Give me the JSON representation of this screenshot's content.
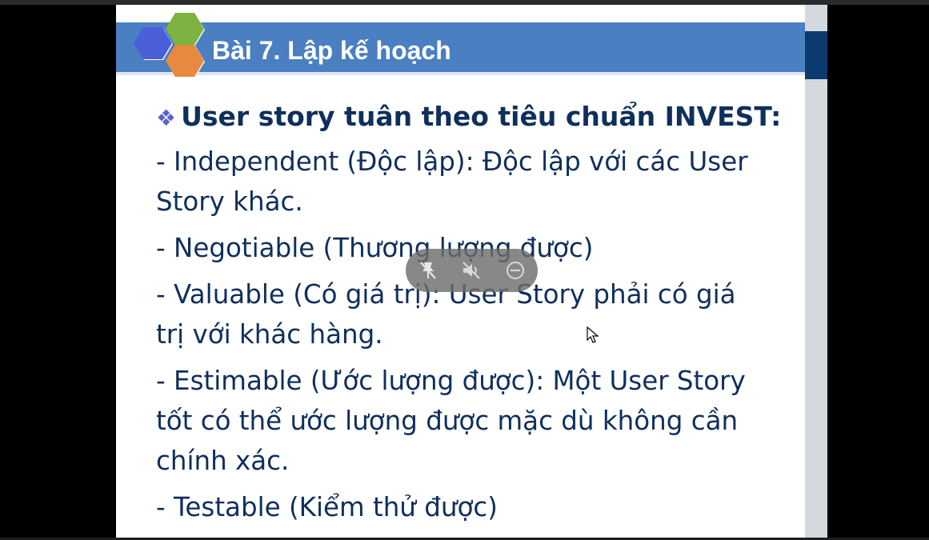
{
  "slide": {
    "title": "Bài 7. Lập kế hoạch",
    "heading_bullet": "❖",
    "heading": "User story tuân theo tiêu chuẩn INVEST:",
    "items": [
      {
        "line1": "- Independent (Độc lập): Độc lập với các User",
        "line2": "Story khác."
      },
      {
        "line1": "- Negotiable (Thương lượng được)",
        "line2": ""
      },
      {
        "line1": "- Valuable (Có giá trị): User Story phải có giá",
        "line2": "trị với khác hàng."
      },
      {
        "line1": "- Estimable (Ước lượng được): Một User Story",
        "line2": "tốt có thể ước lượng được mặc dù không cần",
        "line3": "chính xác."
      },
      {
        "line1": "- Testable (Kiểm thử được)",
        "line2": ""
      }
    ],
    "logo_colors": {
      "blue": "#4a5fd8",
      "green": "#7cb342",
      "orange": "#e8893f"
    },
    "header_color": "#4a7fc1",
    "text_color": "#0f2f5c"
  },
  "controls": {
    "buttons": [
      {
        "icon": "pin-off-icon"
      },
      {
        "icon": "speaker-mute-icon"
      },
      {
        "icon": "minus-circle-icon"
      }
    ]
  },
  "cursor": {
    "icon": "mouse-pointer-icon"
  }
}
